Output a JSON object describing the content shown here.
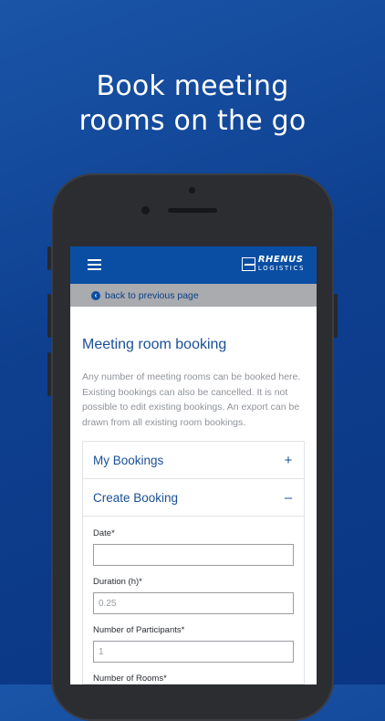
{
  "headline": {
    "line1": "Book meeting",
    "line2": "rooms on the go"
  },
  "app": {
    "logo": {
      "line1": "RHENUS",
      "line2": "LOGISTICS"
    },
    "back_link": "back to previous page",
    "page_title": "Meeting room booking",
    "intro": "Any number of meeting rooms can be booked here. Existing bookings can also be cancelled. It is not possible to edit existing bookings. An export can be drawn from all existing room bookings.",
    "accordion": [
      {
        "label": "My Bookings",
        "sign": "+"
      },
      {
        "label": "Create Booking",
        "sign": "–"
      }
    ],
    "form": {
      "date_label": "Date*",
      "date_value": "",
      "duration_label": "Duration (h)*",
      "duration_value": "0.25",
      "participants_label": "Number of Participants*",
      "participants_value": "1",
      "rooms_label": "Number of Rooms*"
    }
  },
  "colors": {
    "brand_blue": "#0a4ea3",
    "background_blue": "#0e3f8f",
    "link_blue": "#1a4f96",
    "back_bar_gray": "#a9abaf"
  },
  "icons": {
    "menu": "hamburger-icon",
    "back": "chevron-left-circle-icon"
  }
}
